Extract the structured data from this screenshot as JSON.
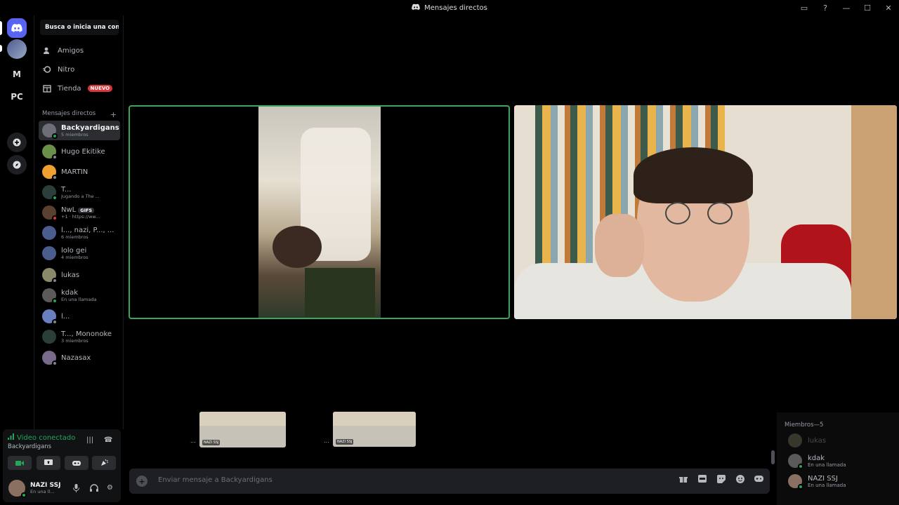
{
  "window": {
    "title": "Mensajes directos"
  },
  "rail": {
    "servers": [
      "M",
      "PC"
    ]
  },
  "sidebar": {
    "search_placeholder": "Busca o inicia una con...",
    "nav": [
      {
        "label": "Amigos",
        "icon": "friends-icon"
      },
      {
        "label": "Nitro",
        "icon": "nitro-icon"
      },
      {
        "label": "Tienda",
        "icon": "shop-icon",
        "badge": "NUEVO"
      }
    ],
    "dm_header": "Mensajes directos",
    "dms": [
      {
        "name": "Backyardigans",
        "sub": "5 miembros",
        "active": true
      },
      {
        "name": "Hugo Ekitike",
        "sub": ""
      },
      {
        "name": "MARTIN",
        "sub": ""
      },
      {
        "name": "T...",
        "sub": "Jugando a The ..."
      },
      {
        "name": "NwL",
        "badge": "GIFS",
        "sub": "+1 · https://ww..."
      },
      {
        "name": "l..., nazi, P..., ...",
        "sub": "6 miembros"
      },
      {
        "name": "lolo gei",
        "sub": "4 miembros"
      },
      {
        "name": "lukas",
        "sub": ""
      },
      {
        "name": "kdak",
        "sub": "En una llamada"
      },
      {
        "name": "l...",
        "sub": ""
      },
      {
        "name": "T..., Mononoke",
        "sub": "3 miembros"
      },
      {
        "name": "Nazasax",
        "sub": ""
      }
    ]
  },
  "voice": {
    "status": "Video conectado",
    "channel": "Backyardigans"
  },
  "user": {
    "name": "NAZI SSJ",
    "status": "En una ll..."
  },
  "thumbnails": {
    "tag1": "NAZI SSJ",
    "tag2": "NAZI SSJ",
    "dots": "..."
  },
  "message": {
    "placeholder": "Enviar mensaje a Backyardigans"
  },
  "members": {
    "header": "Miembros—5",
    "list": [
      {
        "name": "lukas",
        "status": ""
      },
      {
        "name": "kdak",
        "status": "En una llamada"
      },
      {
        "name": "NAZI SSJ",
        "status": "En una llamada"
      }
    ]
  },
  "colors": {
    "accent": "#5865f2",
    "online": "#23a55a",
    "speaking_border": "#3ba55c",
    "new_badge": "#da373c"
  }
}
